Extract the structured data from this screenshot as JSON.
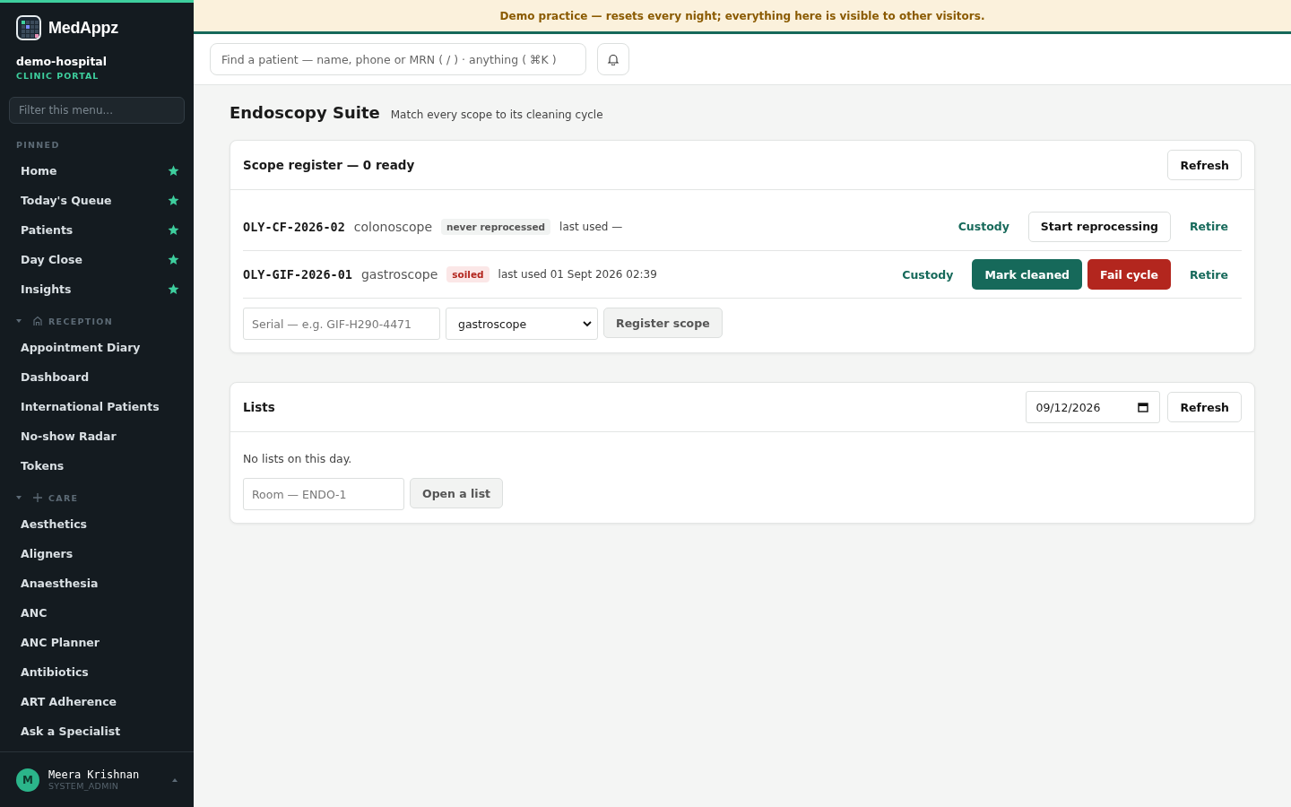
{
  "sidebar": {
    "brand": "MedAppz",
    "org": "demo-hospital",
    "portal": "CLINIC PORTAL",
    "filter": {
      "placeholder": "Filter this menu..."
    },
    "sections": [
      {
        "title": "PINNED",
        "kind": "pinned",
        "items": [
          {
            "label": "Home",
            "pinned": true
          },
          {
            "label": "Today's Queue",
            "pinned": true
          },
          {
            "label": "Patients",
            "pinned": true
          },
          {
            "label": "Day Close",
            "pinned": true
          },
          {
            "label": "Insights",
            "pinned": true
          }
        ]
      },
      {
        "title": "RECEPTION",
        "kind": "group",
        "expanded": true,
        "items": [
          {
            "label": "Appointment Diary",
            "pinned": false
          },
          {
            "label": "Dashboard",
            "pinned": false
          },
          {
            "label": "International Patients",
            "pinned": false
          },
          {
            "label": "No-show Radar",
            "pinned": false
          },
          {
            "label": "Tokens",
            "pinned": false
          }
        ]
      },
      {
        "title": "CARE",
        "kind": "group",
        "expanded": true,
        "items": [
          {
            "label": "Aesthetics",
            "pinned": false
          },
          {
            "label": "Aligners",
            "pinned": false
          },
          {
            "label": "Anaesthesia",
            "pinned": false
          },
          {
            "label": "ANC",
            "pinned": false
          },
          {
            "label": "ANC Planner",
            "pinned": false
          },
          {
            "label": "Antibiotics",
            "pinned": false
          },
          {
            "label": "ART Adherence",
            "pinned": false
          },
          {
            "label": "Ask a Specialist",
            "pinned": false
          }
        ]
      }
    ],
    "user": {
      "initial": "M",
      "name": "Meera Krishnan",
      "role": "SYSTEM_ADMIN"
    }
  },
  "banner": "Demo practice — resets every night; everything here is visible to other visitors.",
  "search": {
    "placeholder": "Find a patient — name, phone or MRN ( / ) · anything ( ⌘K )"
  },
  "page": {
    "title": "Endoscopy Suite",
    "subtitle": "Match every scope to its cleaning cycle"
  },
  "scope_register": {
    "title": "Scope register — 0 ready",
    "refresh": "Refresh",
    "rows": [
      {
        "serial": "OLY-CF-2026-02",
        "type": "colonoscope",
        "status": {
          "label": "never reprocessed",
          "kind": "neutral"
        },
        "last_used": "last used —",
        "actions": [
          {
            "label": "Custody",
            "kind": "link"
          },
          {
            "label": "Start reprocessing",
            "kind": "outline"
          },
          {
            "label": "Retire",
            "kind": "link"
          }
        ]
      },
      {
        "serial": "OLY-GIF-2026-01",
        "type": "gastroscope",
        "status": {
          "label": "soiled",
          "kind": "danger"
        },
        "last_used": "last used 01 Sept 2026 02:39",
        "actions": [
          {
            "label": "Custody",
            "kind": "link"
          },
          {
            "label": "Mark cleaned",
            "kind": "primary"
          },
          {
            "label": "Fail cycle",
            "kind": "danger"
          },
          {
            "label": "Retire",
            "kind": "link"
          }
        ]
      }
    ],
    "form": {
      "serial": {
        "placeholder": "Serial — e.g. GIF-H290-4471"
      },
      "type": {
        "value": "gastroscope"
      },
      "submit": "Register scope"
    }
  },
  "lists": {
    "title": "Lists",
    "date": "09/12/2026",
    "refresh": "Refresh",
    "empty": "No lists on this day.",
    "room": {
      "placeholder": "Room — ENDO-1"
    },
    "submit": "Open a list"
  }
}
